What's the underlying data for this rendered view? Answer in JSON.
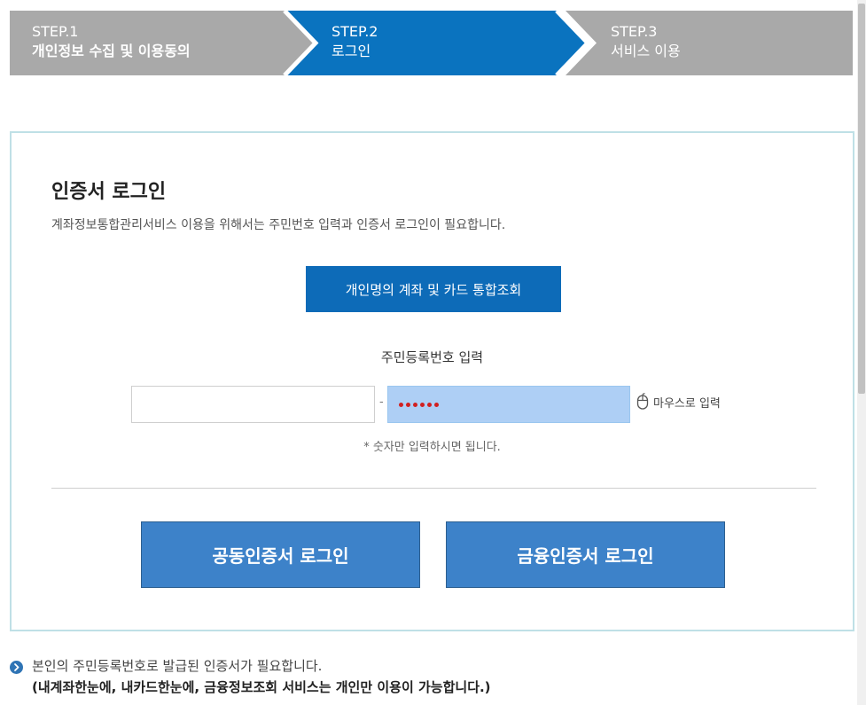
{
  "steps": [
    {
      "num": "STEP.1",
      "label": "개인정보 수집 및 이용동의",
      "color": "#a9a9a9"
    },
    {
      "num": "STEP.2",
      "label": "로그인",
      "color": "#0a73bf"
    },
    {
      "num": "STEP.3",
      "label": "서비스 이용",
      "color": "#a9a9a9"
    }
  ],
  "login": {
    "title": "인증서 로그인",
    "description": "계좌정보통합관리서비스 이용을 위해서는 주민번호 입력과 인증서 로그인이 필요합니다.",
    "integrated_button": "개인명의 계좌 및 카드 통합조회",
    "rrn_label": "주민등록번호 입력",
    "rrn_first_value": "",
    "rrn_dash": "-",
    "rrn_second_masked_count": 6,
    "mouse_input_label": "마우스로 입력",
    "rrn_note": "* 숫자만 입력하시면 됩니다.",
    "common_cert_button": "공동인증서 로그인",
    "financial_cert_button": "금융인증서 로그인"
  },
  "notice": {
    "line1": "본인의 주민등록번호로 발급된 인증서가 필요합니다.",
    "line2": "(내계좌한눈에, 내카드한눈에, 금융정보조회 서비스는 개인만 이용이 가능합니다.)",
    "icon": "chevron-right-circle-icon"
  },
  "colors": {
    "primary_button": "#0d6bb8",
    "cert_button": "#3d82c9",
    "box_border": "#bfe0e6",
    "masked_field_bg": "#aecff5",
    "mask_dot": "#d12020"
  }
}
